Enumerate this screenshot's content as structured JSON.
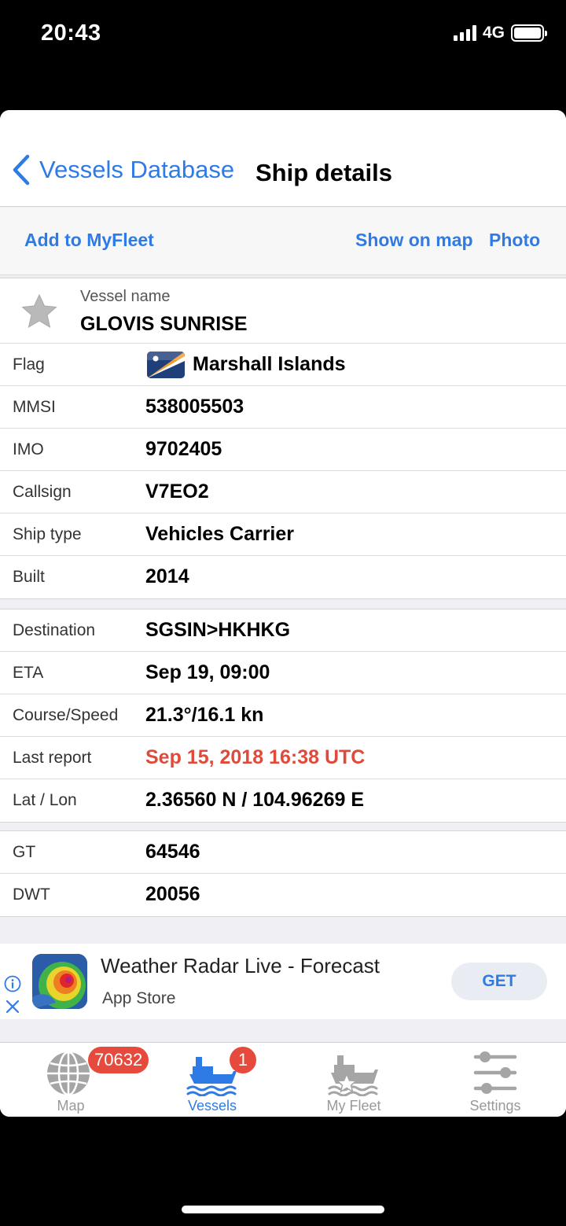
{
  "status": {
    "time": "20:43",
    "network": "4G"
  },
  "nav": {
    "back_label": "Vessels Database",
    "title": "Ship details"
  },
  "actions": {
    "add": "Add to MyFleet",
    "show_map": "Show on map",
    "photo": "Photo"
  },
  "vessel": {
    "name_label": "Vessel name",
    "name": "GLOVIS SUNRISE"
  },
  "details": [
    {
      "label": "Flag",
      "value": "Marshall Islands"
    },
    {
      "label": "MMSI",
      "value": "538005503"
    },
    {
      "label": "IMO",
      "value": "9702405"
    },
    {
      "label": "Callsign",
      "value": "V7EO2"
    },
    {
      "label": "Ship type",
      "value": "Vehicles Carrier"
    },
    {
      "label": "Built",
      "value": "2014"
    }
  ],
  "voyage": [
    {
      "label": "Destination",
      "value": "SGSIN>HKHKG"
    },
    {
      "label": "ETA",
      "value": "Sep 19, 09:00"
    },
    {
      "label": "Course/Speed",
      "value": "21.3°/16.1 kn"
    },
    {
      "label": "Last report",
      "value": "Sep 15, 2018 16:38 UTC"
    },
    {
      "label": "Lat / Lon",
      "value": "2.36560 N / 104.96269 E"
    }
  ],
  "tonnage": [
    {
      "label": "GT",
      "value": "64546"
    },
    {
      "label": "DWT",
      "value": "20056"
    }
  ],
  "ad": {
    "title": "Weather Radar Live - Forecast",
    "subtitle": "App Store",
    "button": "GET"
  },
  "tabs": [
    {
      "label": "Map",
      "badge": "70632",
      "icon": "globe-icon"
    },
    {
      "label": "Vessels",
      "badge": "1",
      "icon": "ship-icon"
    },
    {
      "label": "My Fleet",
      "badge": "",
      "icon": "fleet-ship-star-icon"
    },
    {
      "label": "Settings",
      "badge": "",
      "icon": "sliders-icon"
    }
  ],
  "colors": {
    "accent": "#2f7be6",
    "alert": "#e04a3a",
    "badge": "#e64a3c"
  }
}
